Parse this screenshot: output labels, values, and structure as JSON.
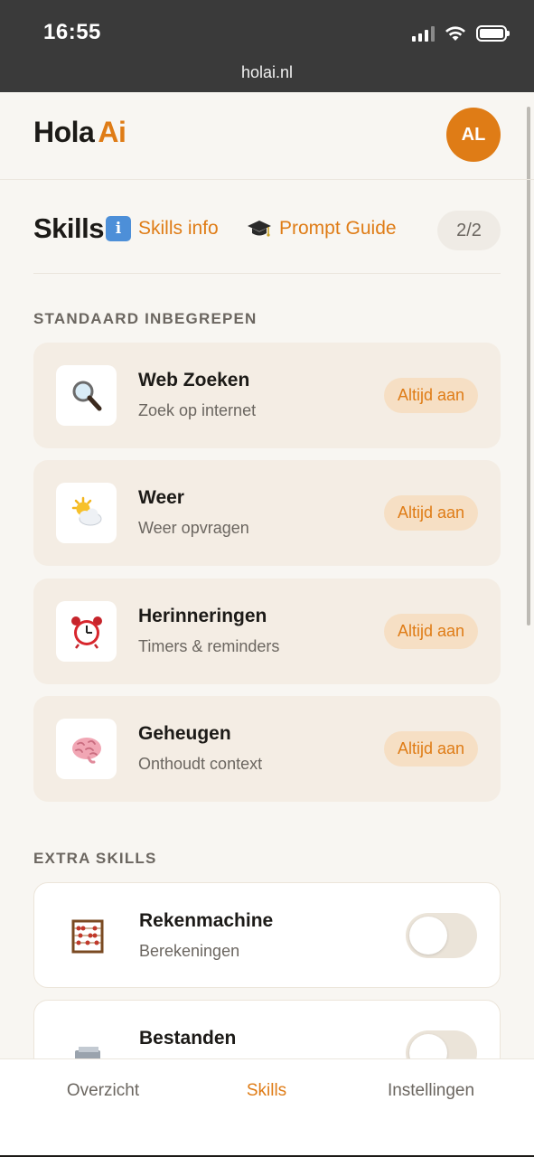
{
  "status_bar": {
    "time": "16:55",
    "url": "holai.nl"
  },
  "header": {
    "logo_main": "Hola",
    "logo_accent": "Ai",
    "avatar_initials": "AL"
  },
  "title_row": {
    "title": "Skills",
    "info_label": "Skills info",
    "guide_label": "Prompt Guide",
    "count": "2/2"
  },
  "sections": {
    "standard_label": "STANDAARD INBEGREPEN",
    "extra_label": "EXTRA SKILLS"
  },
  "standard_skills": [
    {
      "name": "Web Zoeken",
      "desc": "Zoek op internet",
      "badge": "Altijd aan",
      "icon": "magnifier-icon"
    },
    {
      "name": "Weer",
      "desc": "Weer opvragen",
      "badge": "Altijd aan",
      "icon": "sun-cloud-icon"
    },
    {
      "name": "Herinneringen",
      "desc": "Timers & reminders",
      "badge": "Altijd aan",
      "icon": "alarm-clock-icon"
    },
    {
      "name": "Geheugen",
      "desc": "Onthoudt context",
      "badge": "Altijd aan",
      "icon": "brain-icon"
    }
  ],
  "extra_skills": [
    {
      "name": "Rekenmachine",
      "desc": "Berekeningen",
      "enabled": false,
      "icon": "abacus-icon"
    },
    {
      "name": "Bestanden",
      "desc": "",
      "enabled": false,
      "icon": "file-box-icon"
    }
  ],
  "bottom_nav": {
    "overview": "Overzicht",
    "skills": "Skills",
    "settings": "Instellingen",
    "active": "Skills"
  },
  "colors": {
    "accent": "#df7c16",
    "card_bg": "#f4ede4",
    "badge_bg": "#f6dfc4",
    "page_bg": "#f8f6f2"
  }
}
